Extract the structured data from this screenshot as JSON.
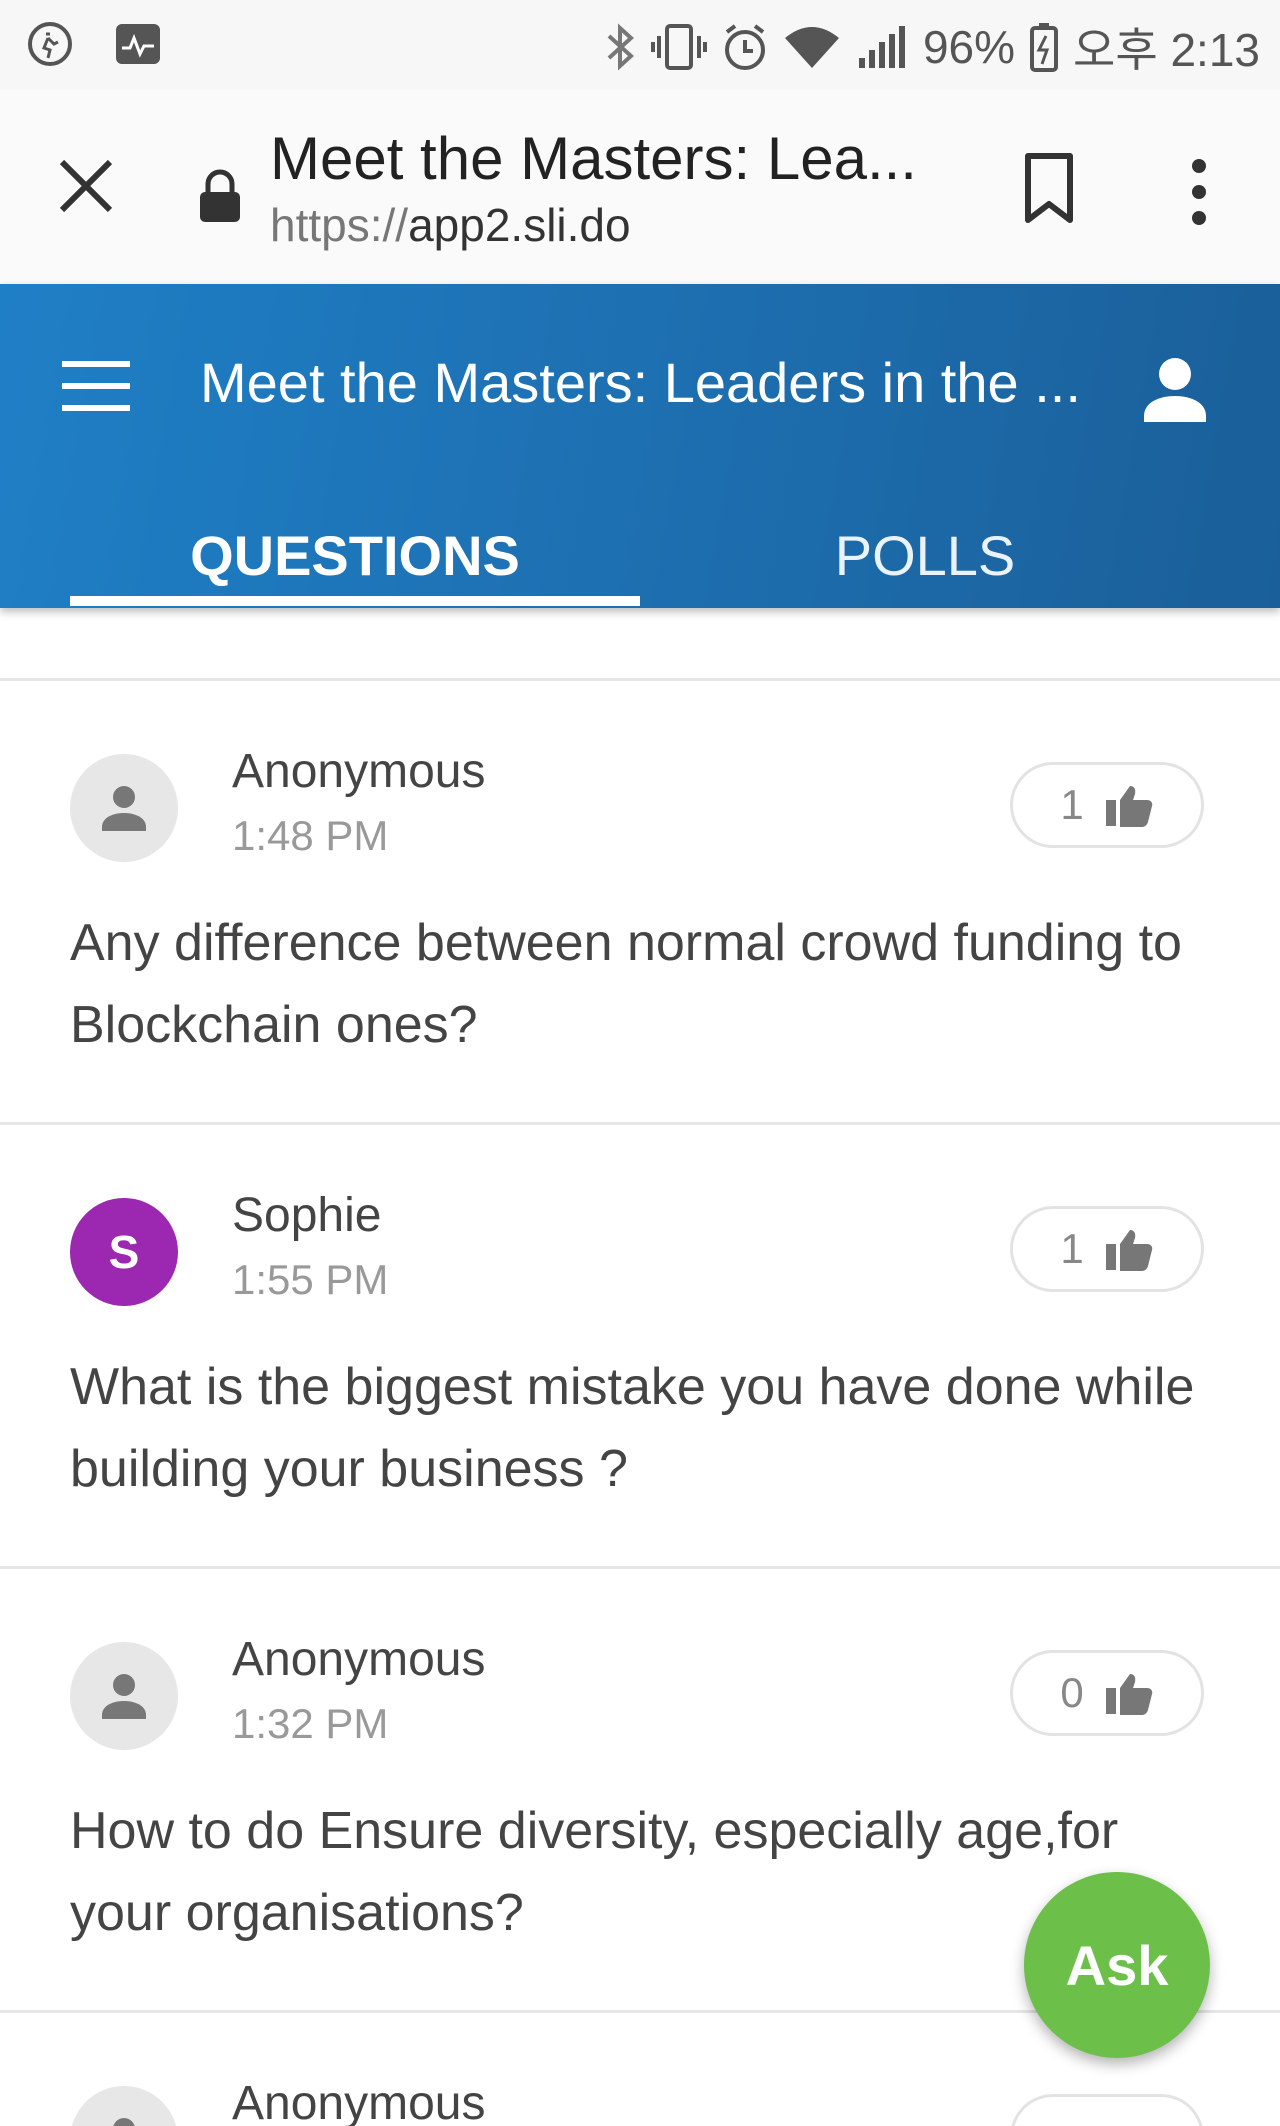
{
  "status_bar": {
    "battery": "96%",
    "time": "오후 2:13",
    "icons": [
      "activity-icon",
      "pulse-icon",
      "bluetooth-icon",
      "vibrate-icon",
      "alarm-icon",
      "wifi-icon",
      "signal-icon",
      "battery-icon"
    ]
  },
  "browser": {
    "page_title": "Meet the Masters: Lea...",
    "url_scheme": "https://",
    "url_host": "app2.sli.do"
  },
  "app": {
    "title": "Meet the Masters: Leaders in the ...",
    "tabs": [
      {
        "label": "QUESTIONS",
        "active": true
      },
      {
        "label": "POLLS",
        "active": false
      }
    ],
    "accent_color": "#1f7fc6"
  },
  "questions": [
    {
      "author": "Anonymous",
      "time": "1:48 PM",
      "likes": "1",
      "text": "Any difference between normal crowd funding to Blockchain ones?",
      "avatar": "person-icon"
    },
    {
      "author": "Sophie",
      "time": "1:55 PM",
      "likes": "1",
      "text": "What is the biggest mistake you have done while building your business ?",
      "avatar_letter": "S",
      "avatar_color": "#9c27b0"
    },
    {
      "author": "Anonymous",
      "time": "1:32 PM",
      "likes": "0",
      "text": "How to do Ensure diversity, especially age,for your organisations?",
      "avatar": "person-icon"
    },
    {
      "author": "Anonymous",
      "time": "",
      "likes": "",
      "text": "",
      "avatar": "person-icon"
    }
  ],
  "ask_button": {
    "label": "Ask",
    "color": "#6cc04a"
  }
}
